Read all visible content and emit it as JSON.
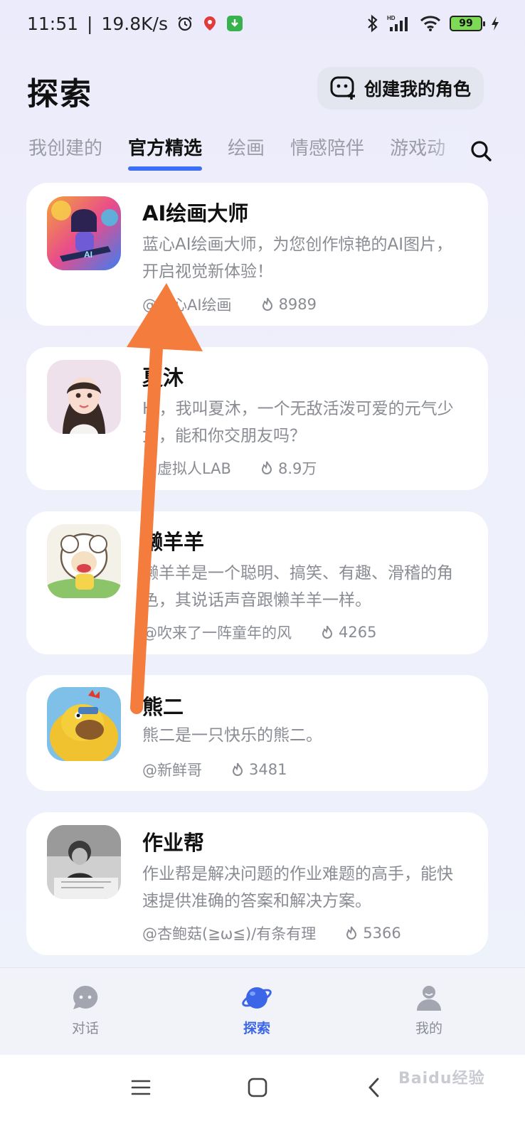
{
  "status_bar": {
    "time": "11:51",
    "speed": "19.8K/s",
    "battery": "99",
    "icons": [
      "alarm-icon",
      "location-pin-icon",
      "download-icon",
      "bluetooth-icon",
      "signal-icon",
      "wifi-icon",
      "battery-icon",
      "charging-icon"
    ]
  },
  "header": {
    "title": "探索",
    "create_button": "创建我的角色"
  },
  "tabs": [
    {
      "label": "我创建的"
    },
    {
      "label": "官方精选"
    },
    {
      "label": "绘画"
    },
    {
      "label": "情感陪伴"
    },
    {
      "label": "游戏动"
    }
  ],
  "cards": [
    {
      "name": "AI绘画大师",
      "desc": "蓝心AI绘画大师，为您创作惊艳的AI图片，开启视觉新体验！",
      "author": "@蓝心AI绘画",
      "heat": "8989"
    },
    {
      "name": "夏沐",
      "desc": "Hi，我叫夏沐，一个无敌活泼可爱的元气少女，能和你交朋友吗？",
      "author": "@虚拟人LAB",
      "heat": "8.9万"
    },
    {
      "name": "懒羊羊",
      "desc": "懒羊羊是一个聪明、搞笑、有趣、滑稽的角色，其说话声音跟懒羊羊一样。",
      "author": "@吹来了一阵童年的风",
      "heat": "4265"
    },
    {
      "name": "熊二",
      "desc": "熊二是一只快乐的熊二。",
      "author": "@新鲜哥",
      "heat": "3481"
    },
    {
      "name": "作业帮",
      "desc": "作业帮是解决问题的作业难题的高手，能快速提供准确的答案和解决方案。",
      "author": "@杏鲍菇(≧ω≦)/有条有理",
      "heat": "5366"
    }
  ],
  "bottom_nav": [
    {
      "label": "对话",
      "icon": "chat-bubble-icon"
    },
    {
      "label": "探索",
      "icon": "planet-icon"
    },
    {
      "label": "我的",
      "icon": "person-icon"
    }
  ],
  "watermark": "Baidu经验",
  "colors": {
    "accent": "#3b66e8",
    "arrow": "#f47c3c",
    "card": "#ffffff"
  }
}
